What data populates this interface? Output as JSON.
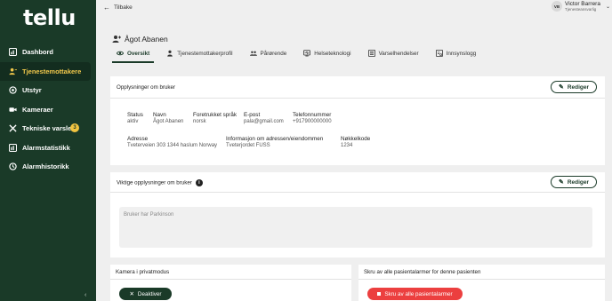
{
  "brand": {
    "logo": "tellu"
  },
  "sidebar": {
    "items": [
      {
        "label": "Dashbord",
        "icon": "dashboard-icon"
      },
      {
        "label": "Tjenestemottakere",
        "icon": "users-icon",
        "active": true
      },
      {
        "label": "Utstyr",
        "icon": "device-icon"
      },
      {
        "label": "Kameraer",
        "icon": "camera-icon"
      },
      {
        "label": "Tekniske varsler",
        "icon": "tools-icon",
        "badge": "3"
      },
      {
        "label": "Alarmstatistikk",
        "icon": "chart-icon"
      },
      {
        "label": "Alarmhistorikk",
        "icon": "history-icon"
      }
    ],
    "collapse_glyph": "‹"
  },
  "topbar": {
    "back_label": "Tilbake",
    "user": {
      "initials": "VB",
      "name": "Victor Barrera",
      "role": "Tjenesteansvarlig"
    }
  },
  "patient": {
    "name": "Ågot Abanen"
  },
  "tabs": [
    {
      "label": "Oversikt",
      "icon": "eye-icon",
      "active": true
    },
    {
      "label": "Tjenestemottakerprofil",
      "icon": "person-icon"
    },
    {
      "label": "Pårørende",
      "icon": "group-icon"
    },
    {
      "label": "Helseteknologi",
      "icon": "monitor-icon"
    },
    {
      "label": "Varselhendelser",
      "icon": "list-icon"
    },
    {
      "label": "Innsynslogg",
      "icon": "log-icon"
    }
  ],
  "info_card": {
    "title": "Opplysninger om bruker",
    "edit_label": "Rediger",
    "fields": {
      "status": {
        "label": "Status",
        "value": "aktiv"
      },
      "name": {
        "label": "Navn",
        "value": "Ågot Abanen"
      },
      "language": {
        "label": "Foretrukket språk",
        "value": "norsk"
      },
      "email": {
        "label": "E-post",
        "value": "pala@gmail.com"
      },
      "phone": {
        "label": "Telefonnummer",
        "value": "+917900000000"
      },
      "address": {
        "label": "Adresse",
        "value": "Tveterveien 303 1344 haslum Norway"
      },
      "address_info": {
        "label": "Informasjon om adressen/eiendommen",
        "value": "Tveterjordet FUSS"
      },
      "key_code": {
        "label": "Nøkkelkode",
        "value": "1234"
      }
    }
  },
  "important_card": {
    "title": "Viktige opplysninger om bruker",
    "info_glyph": "i",
    "edit_label": "Rediger",
    "note": "Bruker har Parkinson"
  },
  "camera_card": {
    "title": "Kamera i privatmodus",
    "button_label": "Deaktiver"
  },
  "alarms_card": {
    "title": "Skru av alle pasientalarmer for denne pasienten",
    "button_label": "Skru av alle pasientalarmer"
  },
  "colors": {
    "sidebar": "#1a3a28",
    "accent": "#f1c84b",
    "danger": "#ec3f3f"
  }
}
